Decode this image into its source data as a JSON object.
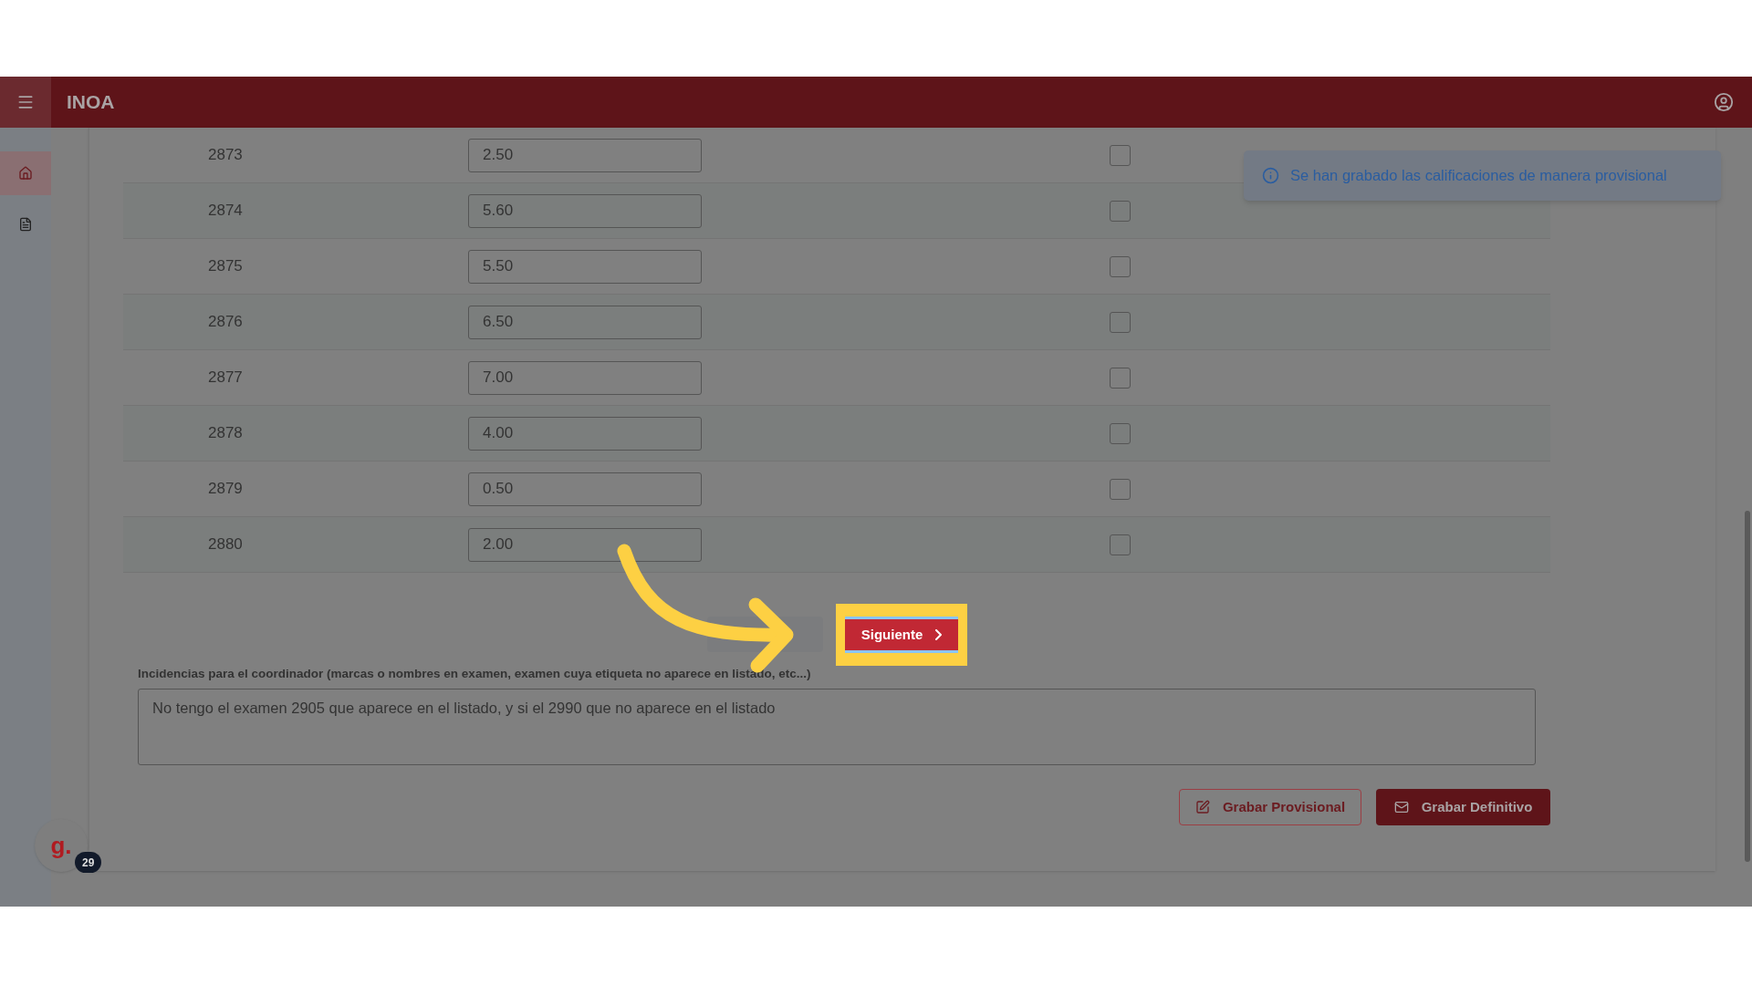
{
  "app_bar": {
    "title": "INOA"
  },
  "sidebar": {
    "items": [
      {
        "kind": "home",
        "selected": true
      },
      {
        "kind": "pdf",
        "selected": false
      }
    ]
  },
  "rows": [
    {
      "exam": "2873",
      "grade": "2.50",
      "checked": false
    },
    {
      "exam": "2874",
      "grade": "5.60",
      "checked": false
    },
    {
      "exam": "2875",
      "grade": "5.50",
      "checked": false
    },
    {
      "exam": "2876",
      "grade": "6.50",
      "checked": false
    },
    {
      "exam": "2877",
      "grade": "7.00",
      "checked": false
    },
    {
      "exam": "2878",
      "grade": "4.00",
      "checked": false
    },
    {
      "exam": "2879",
      "grade": "0.50",
      "checked": false
    },
    {
      "exam": "2880",
      "grade": "2.00",
      "checked": false
    }
  ],
  "notification": {
    "text": "Se han grabado las calificaciones de manera provisional"
  },
  "pager": {
    "next": "Siguiente"
  },
  "incidents": {
    "label": "Incidencias para el coordinador (marcas o nombres en examen, examen cuya etiqueta no aparece en listado, etc...)",
    "value": "No tengo el examen 2905 que aparece en el listado, y si el 2990 que no aparece en el listado"
  },
  "buttons": [
    {
      "kind": "outline",
      "label": "Grabar Provisional"
    },
    {
      "kind": "filled",
      "label": "Grabar Definitivo"
    }
  ],
  "widget": {
    "logo": "g.",
    "count": "29"
  }
}
